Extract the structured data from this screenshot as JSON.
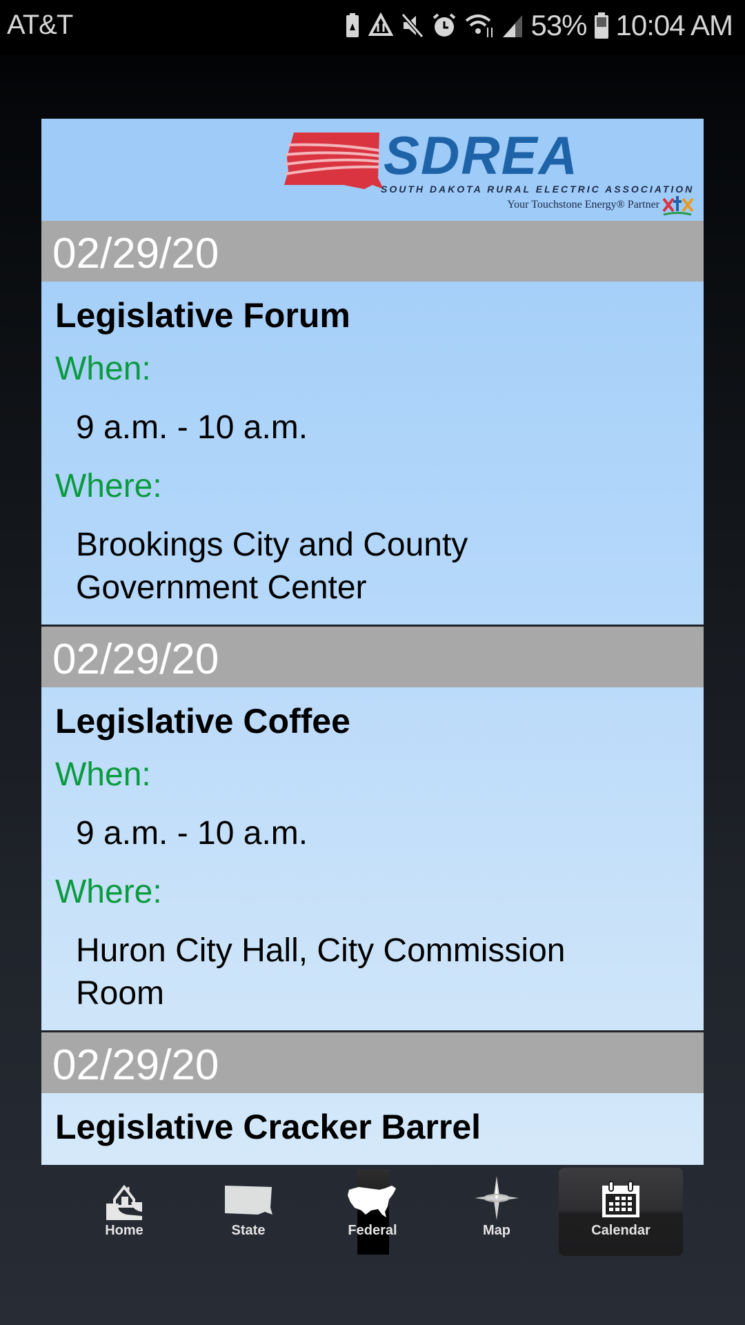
{
  "status_bar": {
    "carrier": "AT&T",
    "icons": [
      "battery-saver-icon",
      "data-saver-icon",
      "mute-icon",
      "alarm-icon",
      "wifi-icon",
      "signal-icon"
    ],
    "battery_percent": "53%",
    "battery_level": 0.53,
    "time": "10:04 AM"
  },
  "header": {
    "logo_name": "SDREA",
    "logo_subtitle": "SOUTH DAKOTA RURAL ELECTRIC ASSOCIATION",
    "logo_tagline": "Your Touchstone Energy® Partner",
    "brand_colors": {
      "primary": "#1e63a8",
      "accent": "#d9343f"
    }
  },
  "labels": {
    "when": "When:",
    "where": "Where:"
  },
  "events": [
    {
      "date": "02/29/20",
      "title": "Legislative Forum",
      "when": "9 a.m. - 10 a.m.",
      "where_line1": "Brookings City and County",
      "where_line2": "Government Center"
    },
    {
      "date": "02/29/20",
      "title": "Legislative Coffee",
      "when": "9 a.m. - 10 a.m.",
      "where_line1": "Huron City Hall, City Commission",
      "where_line2": "Room"
    },
    {
      "date": "02/29/20",
      "title": "Legislative Cracker Barrel",
      "when": "",
      "where_line1": "",
      "where_line2": ""
    }
  ],
  "tabbar": {
    "tabs": [
      {
        "label": "Home",
        "icon": "home-icon"
      },
      {
        "label": "State",
        "icon": "south-dakota-icon"
      },
      {
        "label": "Federal",
        "icon": "usa-map-icon"
      },
      {
        "label": "Map",
        "icon": "compass-star-icon"
      },
      {
        "label": "Calendar",
        "icon": "calendar-icon",
        "selected": true
      }
    ]
  },
  "colors": {
    "date_bar": "#a8a8a8",
    "label_green": "#0a9a3f",
    "panel_blue": "#9ecbf7"
  }
}
